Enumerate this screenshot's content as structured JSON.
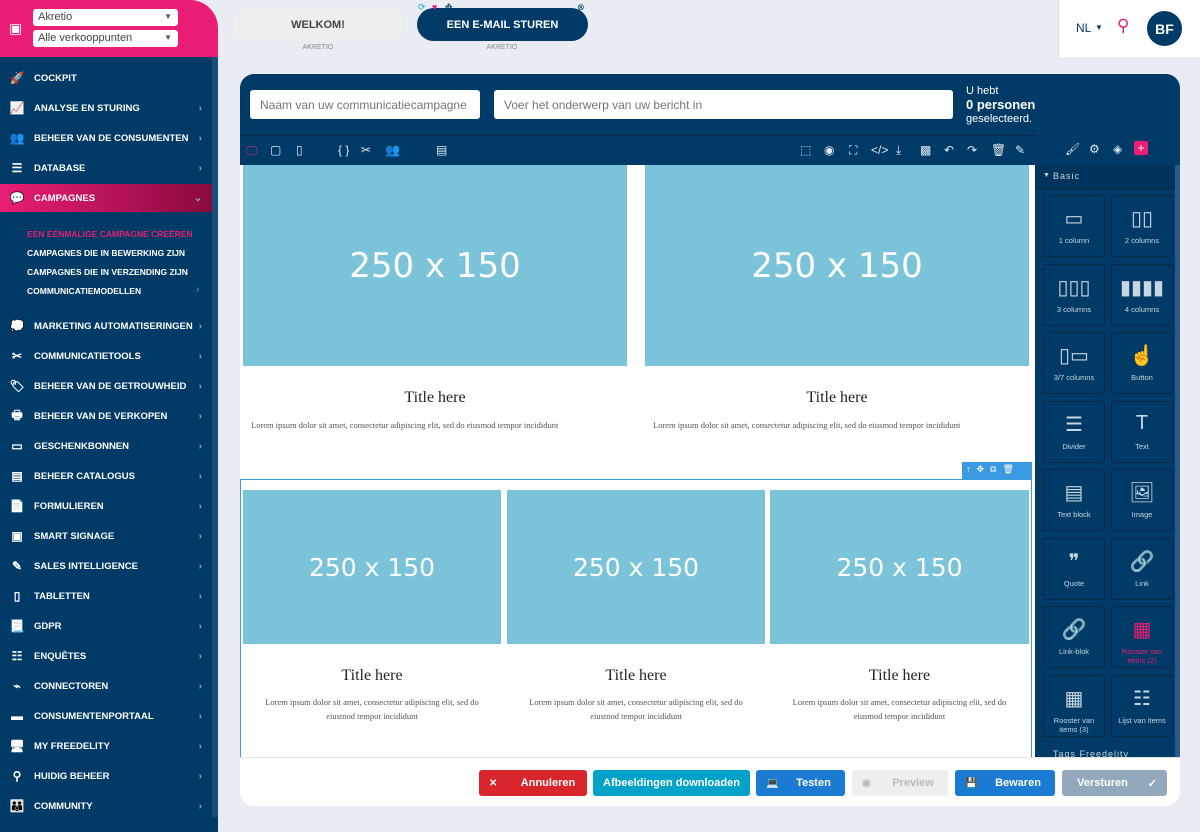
{
  "header": {
    "account": "Akretio",
    "outlet": "Alle verkooppunten",
    "tabs": [
      {
        "label": "WELKOM!",
        "sub": "AKRETIO"
      },
      {
        "label": "EEN E-MAIL STUREN",
        "sub": "AKRETIO"
      }
    ],
    "language": "NL",
    "avatar": "BF"
  },
  "sidebar": {
    "items": [
      {
        "label": "Cockpit",
        "icon": "rocket-icon",
        "g": "🚀"
      },
      {
        "label": "Analyse en sturing",
        "icon": "chart-icon",
        "g": "📈",
        "chev": true
      },
      {
        "label": "Beheer van de consumenten",
        "icon": "users-icon",
        "g": "👥",
        "chev": true
      },
      {
        "label": "Database",
        "icon": "database-icon",
        "g": "☰",
        "chev": true
      },
      {
        "label": "Campagnes",
        "icon": "chat-icon",
        "g": "💬",
        "chev": true,
        "active": true
      },
      {
        "label": "Marketing automatiseringen",
        "icon": "comments-icon",
        "g": "💭",
        "chev": true
      },
      {
        "label": "Communicatietools",
        "icon": "tools-icon",
        "g": "✂",
        "chev": true
      },
      {
        "label": "Beheer van de getrouwheid",
        "icon": "loyalty-icon",
        "g": "🏷",
        "chev": true
      },
      {
        "label": "Beheer van de verkopen",
        "icon": "register-icon",
        "g": "🖶",
        "chev": true
      },
      {
        "label": "Geschenkbonnen",
        "icon": "gift-card-icon",
        "g": "▭",
        "chev": true
      },
      {
        "label": "Beheer catalogus",
        "icon": "catalog-icon",
        "g": "▤",
        "chev": true
      },
      {
        "label": "Formulieren",
        "icon": "form-icon",
        "g": "📄",
        "chev": true
      },
      {
        "label": "Smart signage",
        "icon": "ad-icon",
        "g": "▣",
        "chev": true
      },
      {
        "label": "Sales intelligence",
        "icon": "magic-icon",
        "g": "✎",
        "chev": true
      },
      {
        "label": "Tabletten",
        "icon": "tablet-icon",
        "g": "▯",
        "chev": true
      },
      {
        "label": "GDPR",
        "icon": "file-icon",
        "g": "📃",
        "chev": true
      },
      {
        "label": "Enquêtes",
        "icon": "survey-icon",
        "g": "☷",
        "chev": true
      },
      {
        "label": "Connectoren",
        "icon": "connector-icon",
        "g": "⌁",
        "chev": true
      },
      {
        "label": "Consumentenportaal",
        "icon": "window-icon",
        "g": "▬",
        "chev": true
      },
      {
        "label": "My Freedelity",
        "icon": "devices-icon",
        "g": "🖥",
        "chev": true
      },
      {
        "label": "Huidig beheer",
        "icon": "sitemap-icon",
        "g": "⚲",
        "chev": true
      },
      {
        "label": "Community",
        "icon": "community-icon",
        "g": "👪",
        "chev": true
      }
    ],
    "subitems": [
      {
        "label": "EEN ÉÉNMALIGE CAMPAGNE CREËREN",
        "active": true
      },
      {
        "label": "CAMPAGNES DIE IN BEWERKING ZIJN"
      },
      {
        "label": "CAMPAGNES DIE IN VERZENDING ZIJN"
      },
      {
        "label": "COMMUNICATIEMODELLEN",
        "chev": true
      }
    ]
  },
  "campaign": {
    "name_placeholder": "Naam van uw communicatiecampagne",
    "subject_placeholder": "Voer het onderwerp van uw bericht in",
    "selected_line1": "U hebt",
    "selected_count": "0 personen",
    "selected_line2": "geselecteerd."
  },
  "canvas": {
    "placeholder": "250 x 150",
    "title": "Title here",
    "lorem": "Lorem ipsum dolor sit amet, consectetur adipiscing elit, sed do eiusmod tempor incididunt"
  },
  "blocks": {
    "section_basic": "Basic",
    "section_tags": "Tags Freedelity",
    "items": [
      {
        "label": "1 column",
        "g": "▭"
      },
      {
        "label": "2 columns",
        "g": "▯▯"
      },
      {
        "label": "3 columns",
        "g": "▯▯▯"
      },
      {
        "label": "4 columns",
        "g": "▮▮▮▮"
      },
      {
        "label": "3/7 columns",
        "g": "▯▭"
      },
      {
        "label": "Button",
        "g": "☝"
      },
      {
        "label": "Divider",
        "g": "☰"
      },
      {
        "label": "Text",
        "g": "T"
      },
      {
        "label": "Text block",
        "g": "▤"
      },
      {
        "label": "Image",
        "g": "🖼"
      },
      {
        "label": "Quote",
        "g": "❞"
      },
      {
        "label": "Link",
        "g": "🔗"
      },
      {
        "label": "Link-blok",
        "g": "🔗"
      },
      {
        "label": "Rooster van items (2)",
        "g": "▦",
        "active": true
      },
      {
        "label": "Rooster van items (3)",
        "g": "▦"
      },
      {
        "label": "Lijst van items",
        "g": "☷"
      }
    ]
  },
  "footer": {
    "cancel": "Annuleren",
    "download": "Afbeeldingen downloaden",
    "test": "Testen",
    "preview": "Preview",
    "save": "Bewaren",
    "send": "Versturen"
  },
  "colors": {
    "primary": "#003a66",
    "accent": "#e91e74",
    "placeholder": "#7ac3d9",
    "cancel": "#d9262c",
    "download": "#00a2c7",
    "blue": "#1b7ad1",
    "disabled": "#93a8bd"
  }
}
